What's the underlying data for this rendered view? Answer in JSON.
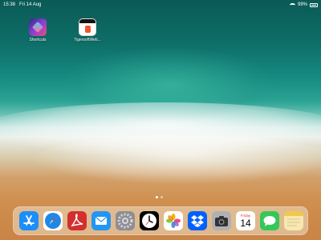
{
  "statusbar": {
    "time": "15:38",
    "date": "Fri 14 Aug",
    "battery": "99%",
    "battery_level": 0.99
  },
  "home": {
    "apps": [
      {
        "label": "Shortcuts",
        "icon": "shortcuts-icon"
      },
      {
        "label": "TigersoftWeb...",
        "icon": "tigersoft-icon"
      }
    ],
    "page_count": 2,
    "current_page": 1
  },
  "dock": {
    "apps": [
      {
        "name": "App Store",
        "icon": "app-store-icon",
        "color": "#1c8ef9"
      },
      {
        "name": "Safari",
        "icon": "safari-icon",
        "color": "#1e88e5"
      },
      {
        "name": "Adobe Acrobat",
        "icon": "acrobat-icon",
        "color": "#d32f2f"
      },
      {
        "name": "Mail",
        "icon": "mail-icon",
        "color": "#2196f3"
      },
      {
        "name": "Settings",
        "icon": "settings-icon",
        "color": "#8e8e93"
      },
      {
        "name": "Clock",
        "icon": "clock-icon",
        "color": "#000000"
      },
      {
        "name": "Photos",
        "icon": "photos-icon",
        "color": "#ffffff"
      },
      {
        "name": "Dropbox",
        "icon": "dropbox-icon",
        "color": "#0061fe"
      },
      {
        "name": "Camera",
        "icon": "camera-icon",
        "color": "#666666"
      },
      {
        "name": "Calendar",
        "icon": "calendar-icon",
        "color": "#ffffff",
        "weekday": "Friday",
        "day": "14"
      },
      {
        "name": "Messages",
        "icon": "messages-icon",
        "color": "#34c759"
      },
      {
        "name": "Notes",
        "icon": "notes-icon",
        "color": "#f7e7b0"
      }
    ]
  }
}
